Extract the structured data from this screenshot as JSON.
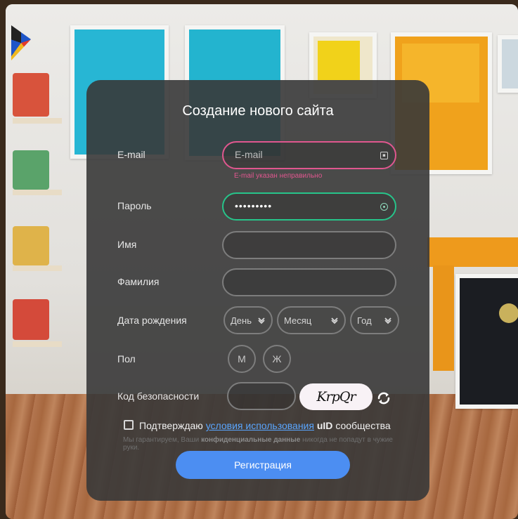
{
  "form": {
    "title": "Создание нового сайта",
    "email": {
      "label": "E-mail",
      "placeholder": "E-mail",
      "value": "",
      "error": "E-mail указан неправильно"
    },
    "password": {
      "label": "Пароль",
      "value": "•••••••••"
    },
    "first_name": {
      "label": "Имя",
      "value": ""
    },
    "last_name": {
      "label": "Фамилия",
      "value": ""
    },
    "birth_date": {
      "label": "Дата рождения",
      "day": "День",
      "month": "Месяц",
      "year": "Год"
    },
    "gender": {
      "label": "Пол",
      "male": "М",
      "female": "Ж"
    },
    "security_code": {
      "label": "Код безопасности",
      "value": "",
      "captcha_text": "KrpQr"
    },
    "consent": {
      "prefix": "Подтверждаю",
      "link": "условия использования",
      "brand": "uID",
      "suffix": "сообщества",
      "note_prefix": "Мы гарантируем, Ваши",
      "note_bold": "конфиденциальные данные",
      "note_suffix": "никогда не попадут в чужие руки."
    },
    "submit_label": "Регистрация"
  },
  "colors": {
    "error": "#e0578f",
    "valid": "#27c48a",
    "accent": "#4c8ef2"
  },
  "icons": [
    "card-icon",
    "eye-icon",
    "chevron-down-icon",
    "refresh-icon"
  ]
}
